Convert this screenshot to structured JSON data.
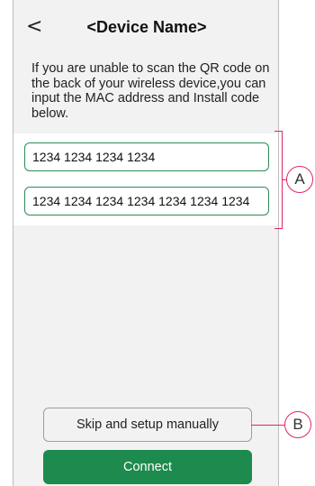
{
  "header": {
    "back_glyph": "<",
    "title": "<Device Name>"
  },
  "instructions": "If you are unable to scan the QR code on the back of your wireless device,you can input the MAC address and Install code below.",
  "fields": {
    "mac_address_value": "1234 1234 1234 1234",
    "install_code_value": "1234 1234 1234 1234 1234 1234 1234"
  },
  "buttons": {
    "skip_label": "Skip and setup manually",
    "connect_label": "Connect"
  },
  "callouts": {
    "a": "A",
    "b": "B"
  },
  "colors": {
    "accent_green": "#1d8a4e",
    "field_border": "#2e8b57",
    "callout_pink": "#e0246a",
    "screen_bg": "#f2f2f2"
  }
}
